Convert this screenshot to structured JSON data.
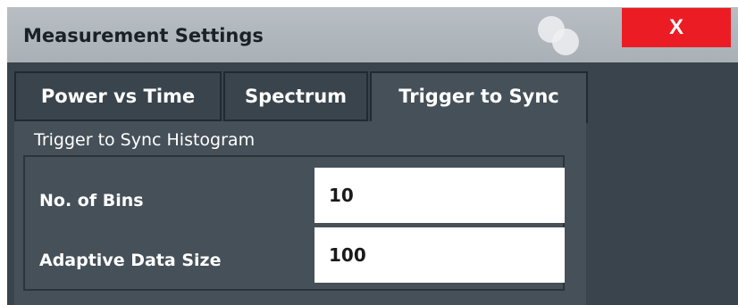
{
  "dialog": {
    "title": "Measurement Settings",
    "close_label": "X",
    "logo_icon": "overlapping-circles-icon",
    "close_color": "#ec1c24"
  },
  "tabs": [
    {
      "label": "Power vs Time",
      "active": false
    },
    {
      "label": "Spectrum",
      "active": false
    },
    {
      "label": "Trigger to Sync",
      "active": true
    }
  ],
  "group": {
    "title": "Trigger to Sync Histogram",
    "fields": [
      {
        "label": "No. of Bins",
        "value": "10"
      },
      {
        "label": "Adaptive Data Size",
        "value": "100"
      }
    ]
  }
}
